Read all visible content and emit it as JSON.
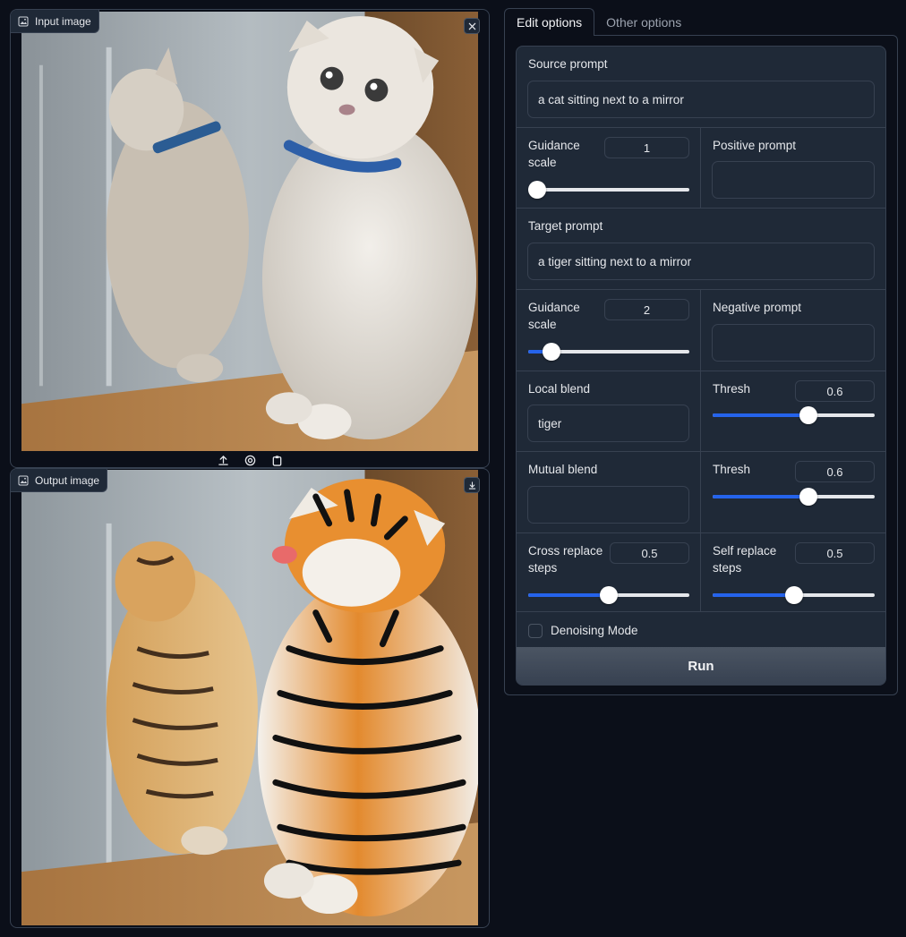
{
  "input_panel": {
    "label": "Input image",
    "image_desc": "cat"
  },
  "output_panel": {
    "label": "Output image",
    "image_desc": "tiger"
  },
  "tabs": [
    {
      "label": "Edit options",
      "active": true
    },
    {
      "label": "Other options",
      "active": false
    }
  ],
  "form": {
    "source_prompt": {
      "label": "Source prompt",
      "value": "a cat sitting next to a mirror"
    },
    "guidance_scale_1": {
      "label": "Guidance scale",
      "value": "1",
      "fraction": 0.0
    },
    "positive_prompt": {
      "label": "Positive prompt",
      "value": ""
    },
    "target_prompt": {
      "label": "Target prompt",
      "value": "a tiger sitting next to a mirror"
    },
    "guidance_scale_2": {
      "label": "Guidance scale",
      "value": "2",
      "fraction": 0.1
    },
    "negative_prompt": {
      "label": "Negative prompt",
      "value": ""
    },
    "local_blend": {
      "label": "Local blend",
      "value": "tiger"
    },
    "thresh_1": {
      "label": "Thresh",
      "value": "0.6",
      "fraction": 0.6
    },
    "mutual_blend": {
      "label": "Mutual blend",
      "value": ""
    },
    "thresh_2": {
      "label": "Thresh",
      "value": "0.6",
      "fraction": 0.6
    },
    "cross_replace": {
      "label": "Cross replace steps",
      "value": "0.5",
      "fraction": 0.5
    },
    "self_replace": {
      "label": "Self replace steps",
      "value": "0.5",
      "fraction": 0.5
    },
    "denoising": {
      "label": "Denoising Mode",
      "checked": false
    },
    "run_label": "Run"
  },
  "colors": {
    "accent": "#2563eb",
    "background": "#0b0f19",
    "panel": "#1f2937",
    "border": "#374151"
  }
}
